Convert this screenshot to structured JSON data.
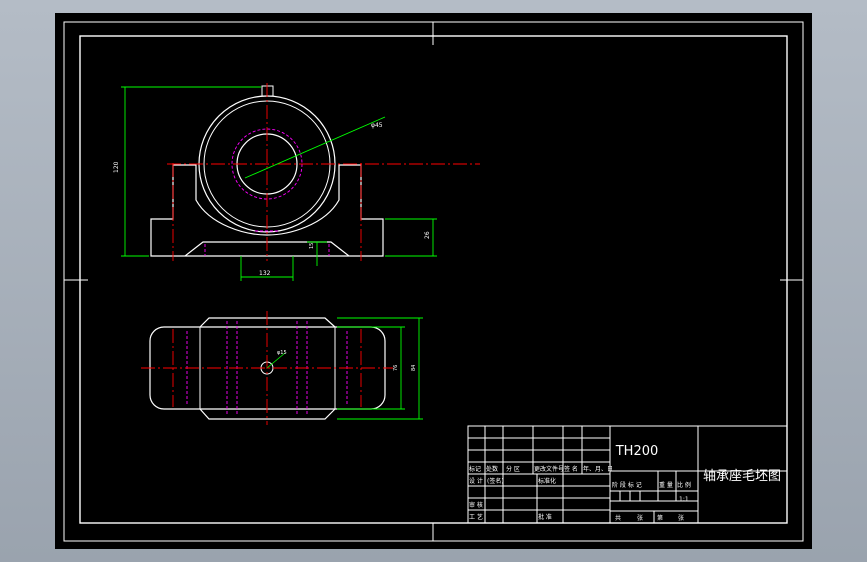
{
  "drawing": {
    "code": "TH200",
    "title": "轴承座毛坯图",
    "scale": "1:1"
  },
  "dimensions": {
    "height_label": "120",
    "bore_diameter_label": "φ45",
    "base_height_label": "26",
    "small_height_label": "15",
    "base_width_label": "132",
    "hole_label": "φ15",
    "inner_width_label": "76",
    "outer_width_label": "84"
  },
  "title_block": {
    "rev_headers": {
      "mark": "标记",
      "count": "处数",
      "zone": "分 区",
      "change_doc": "更改文件号",
      "sign": "签 名",
      "date": "年、月、日"
    },
    "rows": {
      "design": "设 计",
      "sign_date": "(签名)",
      "standard": "标准化",
      "check": "审 核",
      "process": "工 艺",
      "approve": "批 准"
    },
    "stage_headers": {
      "stage_mark": "阶 段 标 记",
      "weight": "重 量",
      "scale": "比 例"
    },
    "sheets": {
      "total": "共",
      "sheet_unit": "张",
      "nth": "第",
      "sheet_unit2": "张"
    }
  },
  "colors": {
    "background": "#000000",
    "outline": "#ffffff",
    "centerline": "#ff0000",
    "dimension": "#00ff00",
    "hidden": "#ff00ff"
  }
}
